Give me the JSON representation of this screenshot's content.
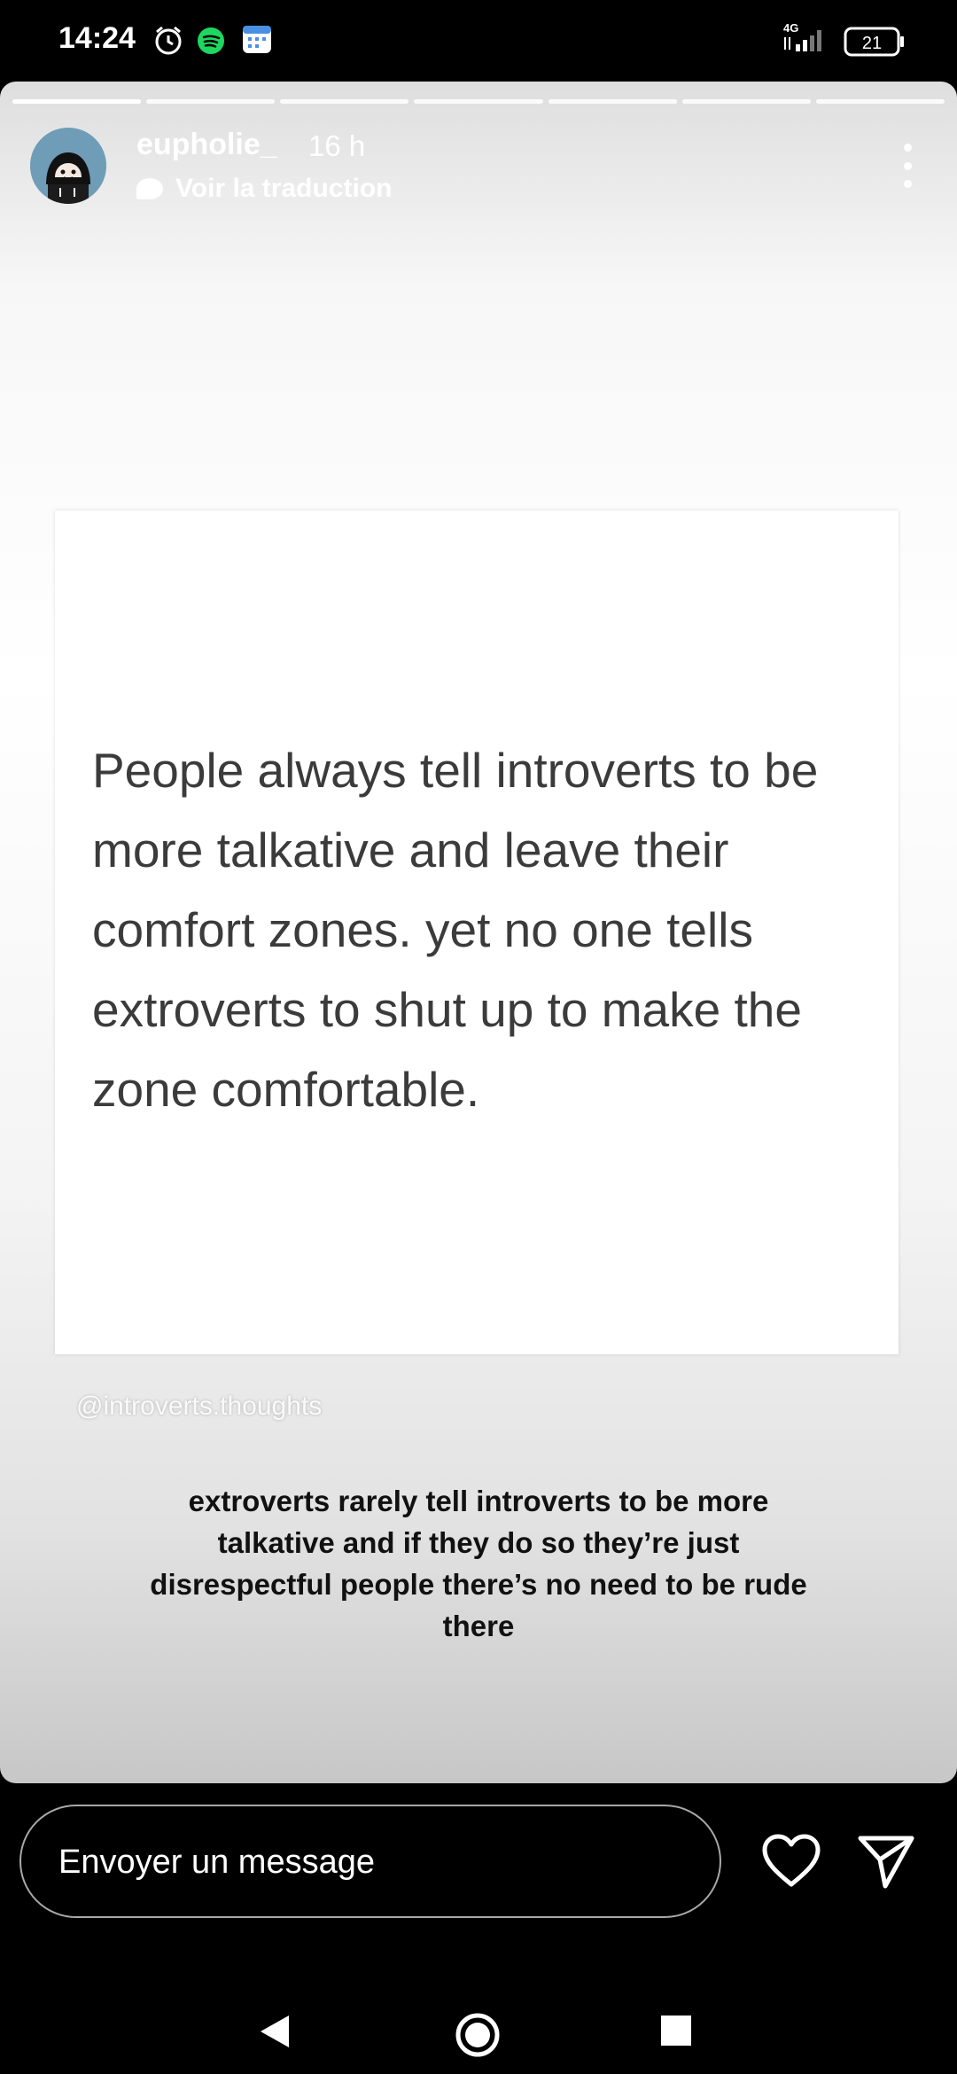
{
  "status_bar": {
    "time": "14:24",
    "network": "4G",
    "battery": "21",
    "icons": [
      "alarm-icon",
      "spotify-icon",
      "calendar-icon",
      "signal-icon",
      "battery-icon"
    ]
  },
  "story": {
    "progress_segments": 7,
    "active_segment": 1,
    "username": "eupholie_",
    "time_ago": "16 h",
    "translate_label": "Voir la traduction",
    "quote": "People always tell introverts to be more talkative and leave their comfort zones. yet no one tells extroverts to shut up to make the zone comfortable.",
    "watermark": "@introverts.thoughts",
    "caption": "extroverts rarely tell introverts to be more talkative and if they do so they’re just disrespectful people there’s no need to be rude there"
  },
  "reply": {
    "placeholder": "Envoyer un message",
    "icons": [
      "heart-icon",
      "send-icon"
    ]
  },
  "navbar": {
    "icons": [
      "back-icon",
      "home-icon",
      "recents-icon"
    ]
  }
}
